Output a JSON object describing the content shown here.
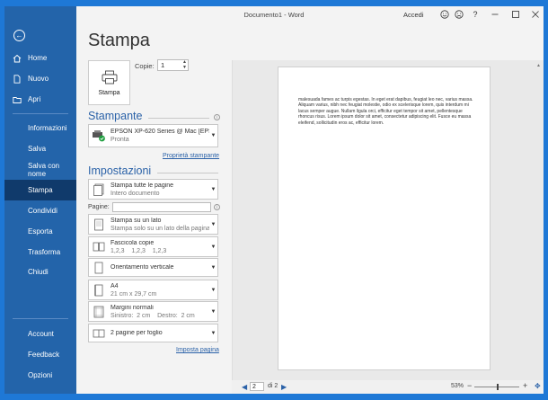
{
  "window": {
    "title": "Documento1 - Word",
    "signin": "Accedi",
    "help": "?"
  },
  "sidebar": {
    "items": [
      {
        "label": "Home",
        "icon": "home-icon"
      },
      {
        "label": "Nuovo",
        "icon": "new-document-icon"
      },
      {
        "label": "Apri",
        "icon": "folder-icon"
      },
      {
        "label": "Informazioni"
      },
      {
        "label": "Salva"
      },
      {
        "label": "Salva con nome"
      },
      {
        "label": "Stampa"
      },
      {
        "label": "Condividi"
      },
      {
        "label": "Esporta"
      },
      {
        "label": "Trasforma"
      },
      {
        "label": "Chiudi"
      }
    ],
    "bottom": [
      {
        "label": "Account"
      },
      {
        "label": "Feedback"
      },
      {
        "label": "Opzioni"
      }
    ],
    "active": "Stampa"
  },
  "print": {
    "heading": "Stampa",
    "button_label": "Stampa",
    "copies_label": "Copie:",
    "copies_value": "1",
    "printer_section": "Stampante",
    "printer_name": "EPSON XP-620 Series @ Mac [EPS...",
    "printer_status": "Pronta",
    "printer_properties": "Proprietà stampante",
    "settings_section": "Impostazioni",
    "pages_label": "Pagine:",
    "pages_value": "",
    "settings": [
      {
        "line1": "Stampa tutte le pagine",
        "line2": "Intero documento",
        "icon": "pages-icon"
      },
      {
        "line1": "Stampa su un lato",
        "line2": "Stampa solo su un lato della pagina",
        "icon": "one-side-icon"
      },
      {
        "line1": "Fascicola copie",
        "line2": "1,2,3    1,2,3    1,2,3",
        "icon": "collate-icon"
      },
      {
        "line1": "Orientamento verticale",
        "line2": "",
        "icon": "portrait-icon"
      },
      {
        "line1": "A4",
        "line2": "21 cm x 29,7 cm",
        "icon": "paper-size-icon"
      },
      {
        "line1": "Margini normali",
        "line2": "Sinistro:  2 cm    Destro:  2 cm",
        "icon": "margins-icon"
      },
      {
        "line1": "2 pagine per foglio",
        "line2": "",
        "icon": "pages-per-sheet-icon"
      }
    ],
    "page_setup": "Imposta pagina"
  },
  "preview": {
    "text": "malesuada fames ac turpis egestas. In eget erat dapibus, feugiat leo nec, varius massa. Aliquam varius, nibh nec feugiat molestie, odio ex scelerisque lorem, quis interdum mi lacus semper augue. Nullam ligula orci, efficitur eget tempor sit amet, pellentesque rhoncus risus. Lorem ipsum dolor sit amet, consectetur adipiscing elit. Fusce eu massa eleifend, sollicitudin eros ac, efficitur lorem."
  },
  "status": {
    "current_page": "2",
    "of_pages": "di 2",
    "zoom": "53%",
    "zoom_fraction": 0.53
  },
  "colors": {
    "sidebar": "#2364aa",
    "sidebar_active": "#103a6b",
    "accent": "#2b62a8",
    "desktop": "#1e78d6"
  }
}
